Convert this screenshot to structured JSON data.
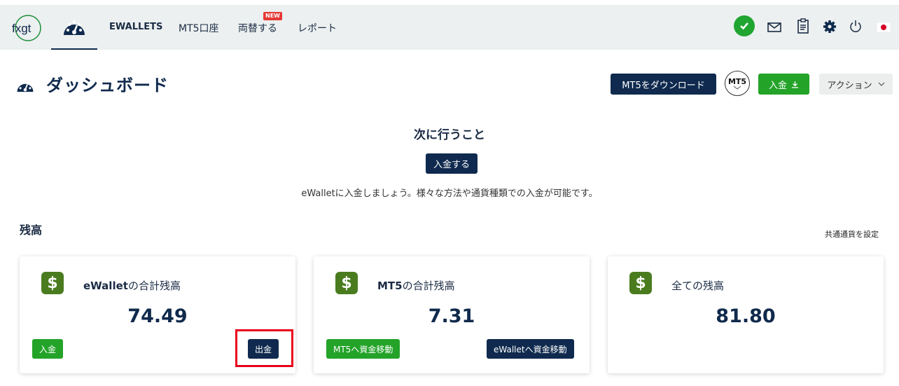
{
  "nav": {
    "logo": "fxgt",
    "links": [
      "EWALLETS",
      "MT5口座",
      "両替する",
      "レポート"
    ],
    "new_badge": "NEW"
  },
  "header": {
    "title": "ダッシュボード",
    "download_mt5": "MT5をダウンロード",
    "mt5_badge": "MT5",
    "deposit": "入金",
    "action": "アクション"
  },
  "next": {
    "title": "次に行うこと",
    "button": "入金する",
    "description": "eWalletに入金しましょう。様々な方法や通貨種類での入金が可能です。"
  },
  "balance": {
    "title": "残高",
    "set_currency": "共通通貨を設定",
    "cards": [
      {
        "label_strong": "eWallet",
        "label_rest": "の合計残高",
        "value": "74.49",
        "btn_left": "入金",
        "btn_right": "出金"
      },
      {
        "label_strong": "MT5",
        "label_rest": "の合計残高",
        "value": "7.31",
        "btn_left": "MT5へ資金移動",
        "btn_right": "eWalletへ資金移動"
      },
      {
        "label_strong": "",
        "label_rest": "全ての残高",
        "value": "81.80"
      }
    ]
  },
  "colors": {
    "navy": "#0f2a4e",
    "green": "#24a329",
    "highlight": "#e8001c"
  }
}
